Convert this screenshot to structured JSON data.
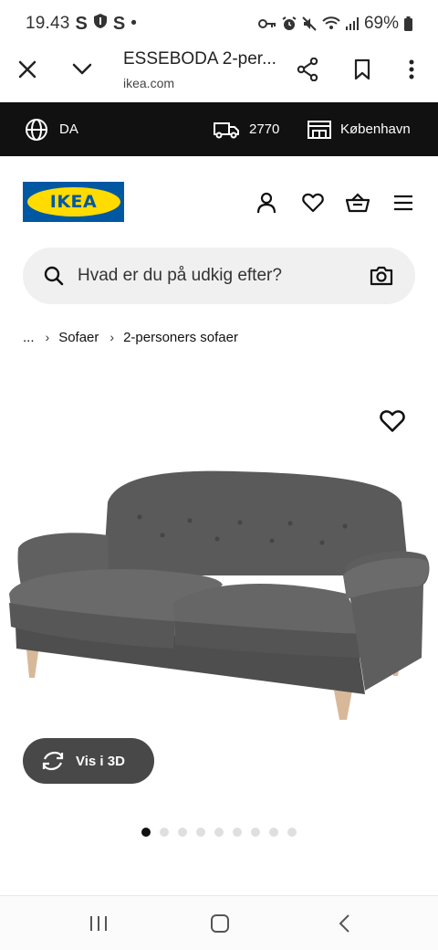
{
  "status_bar": {
    "time": "19.43",
    "indicators": [
      "S",
      "shield-icon",
      "S",
      "•"
    ],
    "battery": "69%"
  },
  "browser": {
    "tab_title": "ESSEBODA 2-per...",
    "url": "ikea.com"
  },
  "topbar": {
    "language": "DA",
    "postcode": "2770",
    "store": "København"
  },
  "header": {
    "logo_text": "IKEA"
  },
  "search": {
    "placeholder": "Hvad er du på udkig efter?"
  },
  "breadcrumb": {
    "ellipsis": "...",
    "items": [
      "Sofaer",
      "2-personers sofaer"
    ]
  },
  "product": {
    "view_3d_label": "Vis i 3D",
    "image_count": 9,
    "active_image_index": 0
  },
  "colors": {
    "topbar_bg": "#111111",
    "logo_blue": "#0058a3",
    "logo_yellow": "#ffdb00",
    "search_bg": "#f0f0f0",
    "view3d_bg": "#484848"
  }
}
